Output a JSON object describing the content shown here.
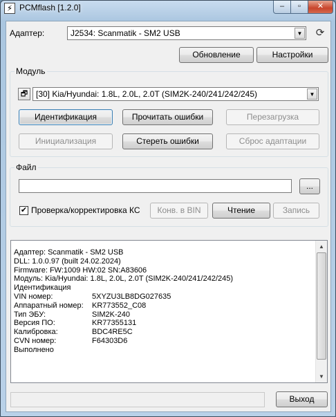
{
  "window": {
    "title": "PCMflash [1.2.0]",
    "icon_glyph": "⚡",
    "controls": {
      "minimize": "–",
      "maximize": "▫",
      "close": "✕"
    }
  },
  "adapter": {
    "label": "Адаптер:",
    "value": "J2534: Scanmatik - SM2 USB",
    "refresh_button": "Обновление",
    "settings_button": "Настройки"
  },
  "module": {
    "group_title": "Модуль",
    "value": "[30] Kia/Hyundai: 1.8L, 2.0L, 2.0T (SIM2K-240/241/242/245)",
    "buttons": {
      "identify": "Идентификация",
      "read_errors": "Прочитать ошибки",
      "reboot": "Перезагрузка",
      "init": "Инициализация",
      "clear_errors": "Стереть ошибки",
      "reset_adaptation": "Сброс адаптации"
    }
  },
  "file": {
    "group_title": "Файл",
    "path_value": "",
    "browse_button": "...",
    "checksum_checkbox_label": "Проверка/корректировка КС",
    "checksum_checked": true,
    "convert_button": "Конв. в BIN",
    "read_button": "Чтение",
    "write_button": "Запись"
  },
  "log": {
    "lines": [
      "Адаптер: Scanmatik - SM2 USB",
      "DLL: 1.0.0.97 (built 24.02.2024)",
      "Firmware: FW:1009 HW:02 SN:A83606",
      "Модуль: Kia/Hyundai: 1.8L, 2.0L, 2.0T (SIM2K-240/241/242/245)",
      "Идентификация"
    ],
    "kv": [
      {
        "k": "VIN номер:",
        "v": "5XYZU3LB8DG027635"
      },
      {
        "k": "Аппаратный номер:",
        "v": "KR773552_C08"
      },
      {
        "k": "Тип ЭБУ:",
        "v": "SIM2K-240"
      },
      {
        "k": "Версия ПО:",
        "v": "KR77355131"
      },
      {
        "k": "Калибровка:",
        "v": "BDC4RE5C"
      },
      {
        "k": "CVN номер:",
        "v": "F64303D6"
      }
    ],
    "footer": "Выполнено"
  },
  "footer": {
    "status_text": "",
    "exit_button": "Выход"
  }
}
